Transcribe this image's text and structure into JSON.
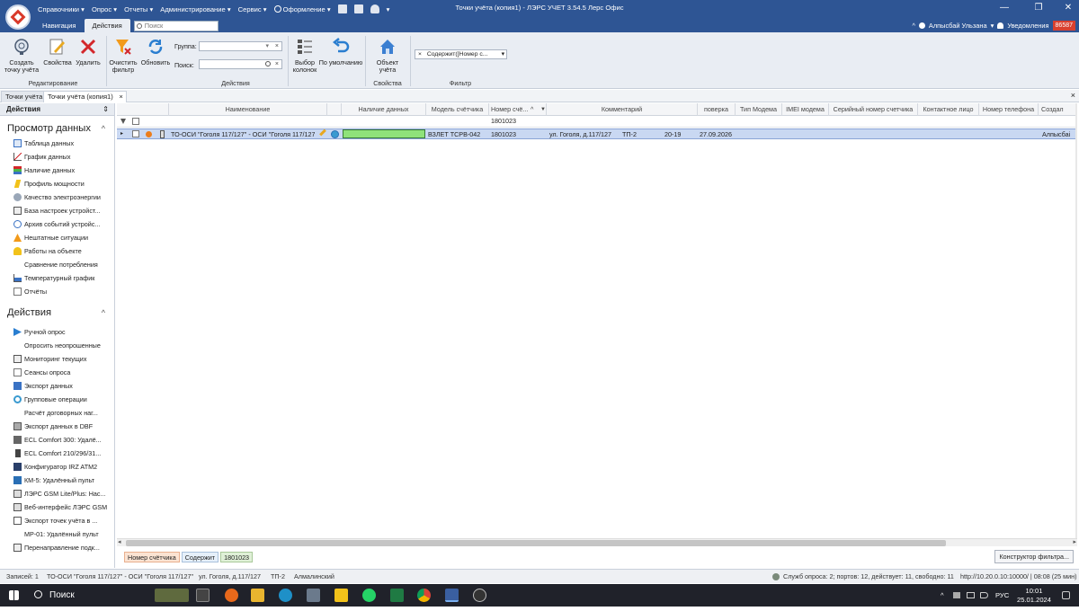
{
  "window": {
    "title": "Точки учёта (копия1) - ЛЭРС УЧЕТ 3.54.5 Лерс Офис",
    "minimize": "—",
    "maximize": "❐",
    "close": "✕"
  },
  "menu": {
    "items": [
      "Справочники ▾",
      "Опрос ▾",
      "Отчеты ▾",
      "Администрирование ▾",
      "Сервис ▾",
      "Оформление ▾"
    ],
    "dropdown": "▾"
  },
  "ribbon_tabs": {
    "nav": "Навигация",
    "actions": "Действия",
    "search_placeholder": "Поиск"
  },
  "user": {
    "caret": "^",
    "name": "Алпысбай Ульзана",
    "chev": "▾",
    "notifications": "Уведомления",
    "count": "86587"
  },
  "ribbon": {
    "create": "Создать точку учёта",
    "properties": "Свойства",
    "delete": "Удалить",
    "group_edit": "Редактирование",
    "clear_filter": "Очистить фильтр",
    "refresh": "Обновить",
    "group_label": "Группа:",
    "search_label": "Поиск:",
    "group_actions": "Действия",
    "columns": "Выбор колонок",
    "default": "По умолчанию",
    "object": "Объект учёта",
    "group_props": "Свойства",
    "filter_value": "Содержит([Номер с...",
    "group_filter": "Фильтр"
  },
  "doc_tabs": {
    "tab1": "Точки учёта",
    "tab2": "Точки учёта (копия1)",
    "close": "×",
    "close_all": "×"
  },
  "sidebar": {
    "header": "Действия",
    "pin": "⇕",
    "sec1": "Просмотр данных",
    "sec1_chev": "^",
    "view_items": [
      "Таблица данных",
      "График данных",
      "Наличие данных",
      "Профиль мощности",
      "Качество электроэнергии",
      "База настроек устройст...",
      "Архив событий устройс...",
      "Нештатные ситуации",
      "Работы на объекте",
      "Сравнение потребления",
      "Температурный график",
      "Отчёты"
    ],
    "sec2": "Действия",
    "sec2_chev": "^",
    "action_items": [
      "Ручной опрос",
      "Опросить неопрошенные",
      "Мониторинг текущих",
      "Сеансы опроса",
      "Экспорт данных",
      "Групповые операции",
      "Расчёт договорных наг...",
      "Экспорт данных в DBF",
      "ECL Comfort 300: Удалё...",
      "ECL Comfort 210/296/31...",
      "Конфигуратор IRZ ATM2",
      "КМ-5: Удалённый пульт",
      "ЛЭРС GSM Lite/Plus: Нас...",
      "Веб-интерфейс ЛЭРС GSM",
      "Экспорт точек учёта в ...",
      "МР-01: Удалённый пульт",
      "Перенаправление подк..."
    ]
  },
  "grid": {
    "columns": {
      "name": "Наименование",
      "data": "Наличие данных",
      "model": "Модель счётчика",
      "number": "Номер счё...",
      "comment": "Комментарий",
      "check": "поверка",
      "modem": "Тип Модема",
      "imei": "IMEI модема",
      "serial": "Серийный номер счетчика",
      "contact": "Контактное лицо",
      "phone": "Номер телефона",
      "created": "Создал"
    },
    "filter_number": "1801023",
    "row": {
      "arrow": "▸",
      "name": "ТО-ОСИ \"Гоголя 117/127\" - ОСИ \"Гоголя 117/127\"",
      "model": "ВЗЛЕТ ТСРВ-042",
      "number": "1801023",
      "comment_addr": "ул. Гоголя, д.117/127",
      "comment_tp": "ТП-2",
      "comment_range": "20-19",
      "check": "27.09.2026",
      "created": "Алпысбаі"
    }
  },
  "filter_chips": [
    "Номер счётчика",
    "Содержит",
    "1801023"
  ],
  "filter_button": "Конструктор фильтра...",
  "status": {
    "records": "Записей: 1",
    "name": "ТО-ОСИ \"Гоголя 117/127\" - ОСИ \"Гоголя 117/127\"",
    "addr": "ул. Гоголя, д.117/127",
    "tp": "ТП-2",
    "city": "Алмалинский",
    "service": "Служб опроса: 2; портов: 12, действует: 11, свободно: 11",
    "server": "http://10.20.0.10:10000/ | 08:08 (25 мин)"
  },
  "taskbar": {
    "search": "Поиск",
    "lang": "РУС",
    "time": "10:01",
    "date": "25.01.2024",
    "tray_caret": "^"
  },
  "colors": {
    "accent": "#2e5594",
    "selection": "#c9d8f2",
    "data_bar": "#8fe27a",
    "badge": "#d9402f"
  }
}
